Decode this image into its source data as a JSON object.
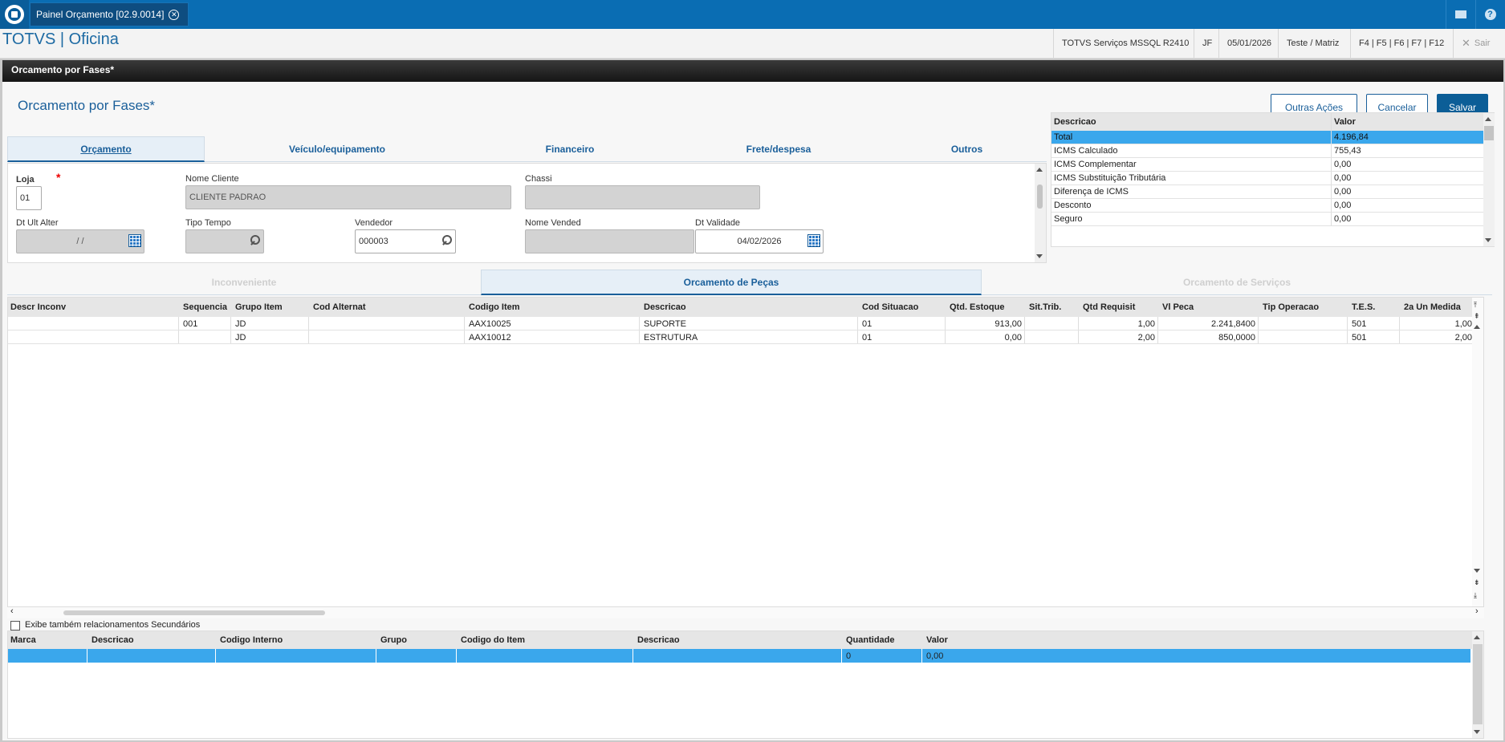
{
  "topbar": {
    "tab_label": "Painel Orçamento [02.9.0014]",
    "tab_close": "✕"
  },
  "header": {
    "brand": "TOTVS | Oficina",
    "env": "TOTVS Serviços MSSQL R2410",
    "user": "JF",
    "date": "05/01/2026",
    "company": "Teste / Matriz",
    "shortcuts": "F4 | F5 | F6 | F7 | F12",
    "exit": "Sair"
  },
  "strip_title": "Orcamento por Fases*",
  "page": {
    "title": "Orcamento por Fases*",
    "btn_more": "Outras Ações",
    "btn_cancel": "Cancelar",
    "btn_save": "Salvar"
  },
  "tabs": [
    "Orçamento",
    "Veículo/equipamento",
    "Financeiro",
    "Frete/despesa",
    "Outros"
  ],
  "form": {
    "loja_label": "Loja",
    "loja_value": "01",
    "nome_cliente_label": "Nome Cliente",
    "nome_cliente_value": "CLIENTE PADRAO",
    "chassi_label": "Chassi",
    "chassi_value": "",
    "dt_ult_alter_label": "Dt Ult Alter",
    "dt_ult_alter_value": "/ /",
    "tipo_tempo_label": "Tipo Tempo",
    "tipo_tempo_value": "",
    "vendedor_label": "Vendedor",
    "vendedor_value": "000003",
    "nome_vended_label": "Nome Vended",
    "nome_vended_value": "",
    "dt_validade_label": "Dt Validade",
    "dt_validade_value": "04/02/2026"
  },
  "summary": {
    "headers": [
      "Descricao",
      "Valor"
    ],
    "rows": [
      [
        "Total",
        "4.196,84"
      ],
      [
        "ICMS Calculado",
        "755,43"
      ],
      [
        "ICMS Complementar",
        "0,00"
      ],
      [
        "ICMS Substituição Tributária",
        "0,00"
      ],
      [
        "Diferença de ICMS",
        "0,00"
      ],
      [
        "Desconto",
        "0,00"
      ],
      [
        "Seguro",
        "0,00"
      ]
    ]
  },
  "tabs2": [
    "Inconveniente",
    "Orcamento de Peças",
    "Orcamento de Serviços"
  ],
  "items": {
    "headers": [
      "Descr Inconv",
      "Sequencia",
      "Grupo Item",
      "Cod Alternat",
      "Codigo Item",
      "Descricao",
      "Cod Situacao",
      "Qtd. Estoque",
      "Sit.Trib.",
      "Qtd Requisit",
      "Vl Peca",
      "Tip Operacao",
      "T.E.S.",
      "2a Un Medida"
    ],
    "rows": [
      [
        "",
        "001",
        "JD",
        "",
        "AAX10025",
        "SUPORTE",
        "01",
        "913,00",
        "",
        "1,00",
        "2.241,8400",
        "",
        "501",
        "1,00"
      ],
      [
        "",
        "",
        "JD",
        "",
        "AAX10012",
        "ESTRUTURA",
        "01",
        "0,00",
        "",
        "2,00",
        "850,0000",
        "",
        "501",
        "2,00"
      ]
    ]
  },
  "checkbox_label": "Exibe também relacionamentos Secundários",
  "related": {
    "headers": [
      "Marca",
      "Descricao",
      "Codigo Interno",
      "Grupo",
      "Codigo do Item",
      "Descricao",
      "Quantidade",
      "Valor"
    ],
    "row": [
      "",
      "",
      "",
      "",
      "",
      "",
      "0",
      "0,00"
    ]
  },
  "colors": {
    "accent": "#0a6db3",
    "selection": "#3aa7ec",
    "brand_text": "#1d6aa3"
  }
}
